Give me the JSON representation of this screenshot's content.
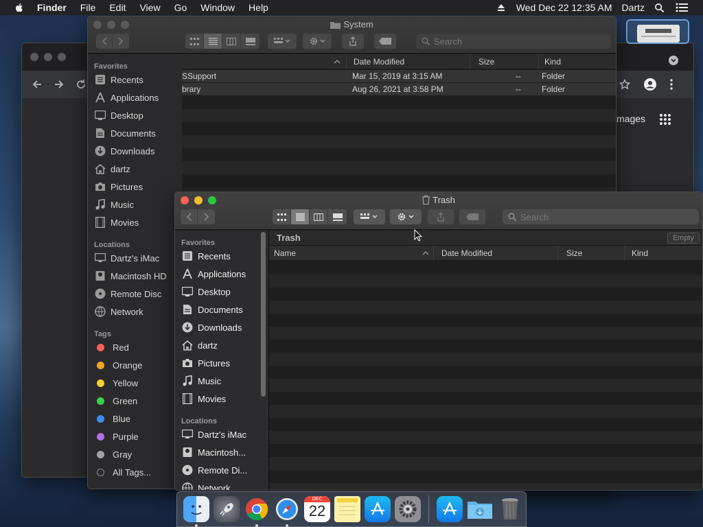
{
  "menubar": {
    "app_name": "Finder",
    "menus": [
      "File",
      "Edit",
      "View",
      "Go",
      "Window",
      "Help"
    ],
    "clock": "Wed Dec 22  12:35 AM",
    "user": "Dartz"
  },
  "bg_browser": {
    "images_link": "mages"
  },
  "system_window": {
    "title": "System",
    "search_placeholder": "Search",
    "columns": {
      "date": "Date Modified",
      "size": "Size",
      "kind": "Kind"
    },
    "rows": [
      {
        "name": "SSupport",
        "date": "Mar 15, 2019 at 3:15 AM",
        "size": "--",
        "kind": "Folder"
      },
      {
        "name": "brary",
        "date": "Aug 26, 2021 at 3:58 PM",
        "size": "--",
        "kind": "Folder"
      }
    ],
    "sidebar": {
      "favorites_header": "Favorites",
      "favorites": [
        "Recents",
        "Applications",
        "Desktop",
        "Documents",
        "Downloads",
        "dartz",
        "Pictures",
        "Music",
        "Movies"
      ],
      "locations_header": "Locations",
      "locations": [
        "Dartz's iMac",
        "Macintosh HD",
        "Remote Disc",
        "Network"
      ],
      "tags_header": "Tags",
      "tags": [
        {
          "label": "Red",
          "color": "#fe5f57"
        },
        {
          "label": "Orange",
          "color": "#f5a623"
        },
        {
          "label": "Yellow",
          "color": "#f8d12f"
        },
        {
          "label": "Green",
          "color": "#3ecf4e"
        },
        {
          "label": "Blue",
          "color": "#3b8ef0"
        },
        {
          "label": "Purple",
          "color": "#b56ee6"
        },
        {
          "label": "Gray",
          "color": "#a3a3a3"
        }
      ],
      "all_tags": "All Tags..."
    }
  },
  "trash_window": {
    "title": "Trash",
    "search_placeholder": "Search",
    "path_label": "Trash",
    "empty_button": "Empty",
    "columns": {
      "name": "Name",
      "date": "Date Modified",
      "size": "Size",
      "kind": "Kind"
    },
    "sidebar": {
      "favorites_header": "Favorites",
      "favorites": [
        "Recents",
        "Applications",
        "Desktop",
        "Documents",
        "Downloads",
        "dartz",
        "Pictures",
        "Music",
        "Movies"
      ],
      "locations_header": "Locations",
      "locations": [
        "Dartz's iMac",
        "Macintosh...",
        "Remote Di...",
        "Network"
      ]
    }
  },
  "dock": {
    "calendar_month": "DEC",
    "calendar_day": "22"
  }
}
